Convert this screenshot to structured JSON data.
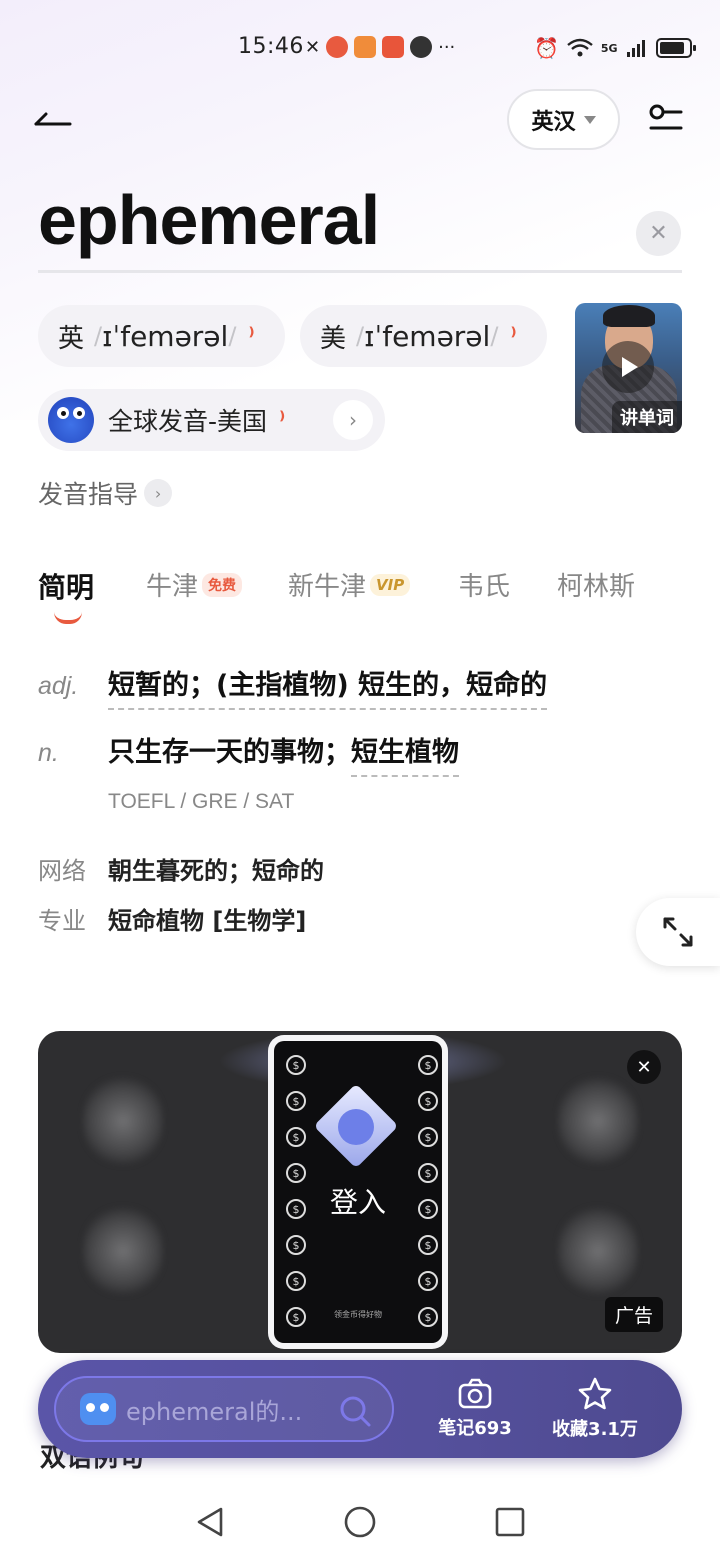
{
  "status_bar": {
    "time": "15:46",
    "more": "···",
    "network_label": "5G"
  },
  "header": {
    "lang_label": "英汉"
  },
  "word": "ephemeral",
  "pronunciation": {
    "uk": {
      "lang": "英",
      "ipa": "ɪˈfemərəl"
    },
    "us": {
      "lang": "美",
      "ipa": "ɪˈfemərəl"
    },
    "global": "全球发音-美国",
    "guide": "发音指导",
    "video_label": "讲单词"
  },
  "tabs": [
    {
      "label": "简明"
    },
    {
      "label": "牛津",
      "badge": "免费"
    },
    {
      "label": "新牛津",
      "badge": "VIP"
    },
    {
      "label": "韦氏"
    },
    {
      "label": "柯林斯"
    }
  ],
  "definitions": [
    {
      "pos": "adj.",
      "text": "短暂的；(主指植物) 短生的，短命的"
    },
    {
      "pos": "n.",
      "text_plain": "只生存一天的事物；",
      "text_dashed": "短生植物"
    }
  ],
  "exams": "TOEFL / GRE / SAT",
  "extra": [
    {
      "label": "网络",
      "text": "朝生暮死的；短命的"
    },
    {
      "label": "专业",
      "text": "短命植物 [生物学]"
    }
  ],
  "ad": {
    "login_text": "登入",
    "small_text": "领金币得好物",
    "tag": "广告"
  },
  "bottom_bar": {
    "search_placeholder": "ephemeral的...",
    "notes_label": "笔记693",
    "favorites_label": "收藏3.1万"
  },
  "section_label": "双语例句",
  "colors": {
    "accent": "#e85a3f",
    "bar_bg": "#5a55a8",
    "vip_gold": "#c9962e"
  }
}
